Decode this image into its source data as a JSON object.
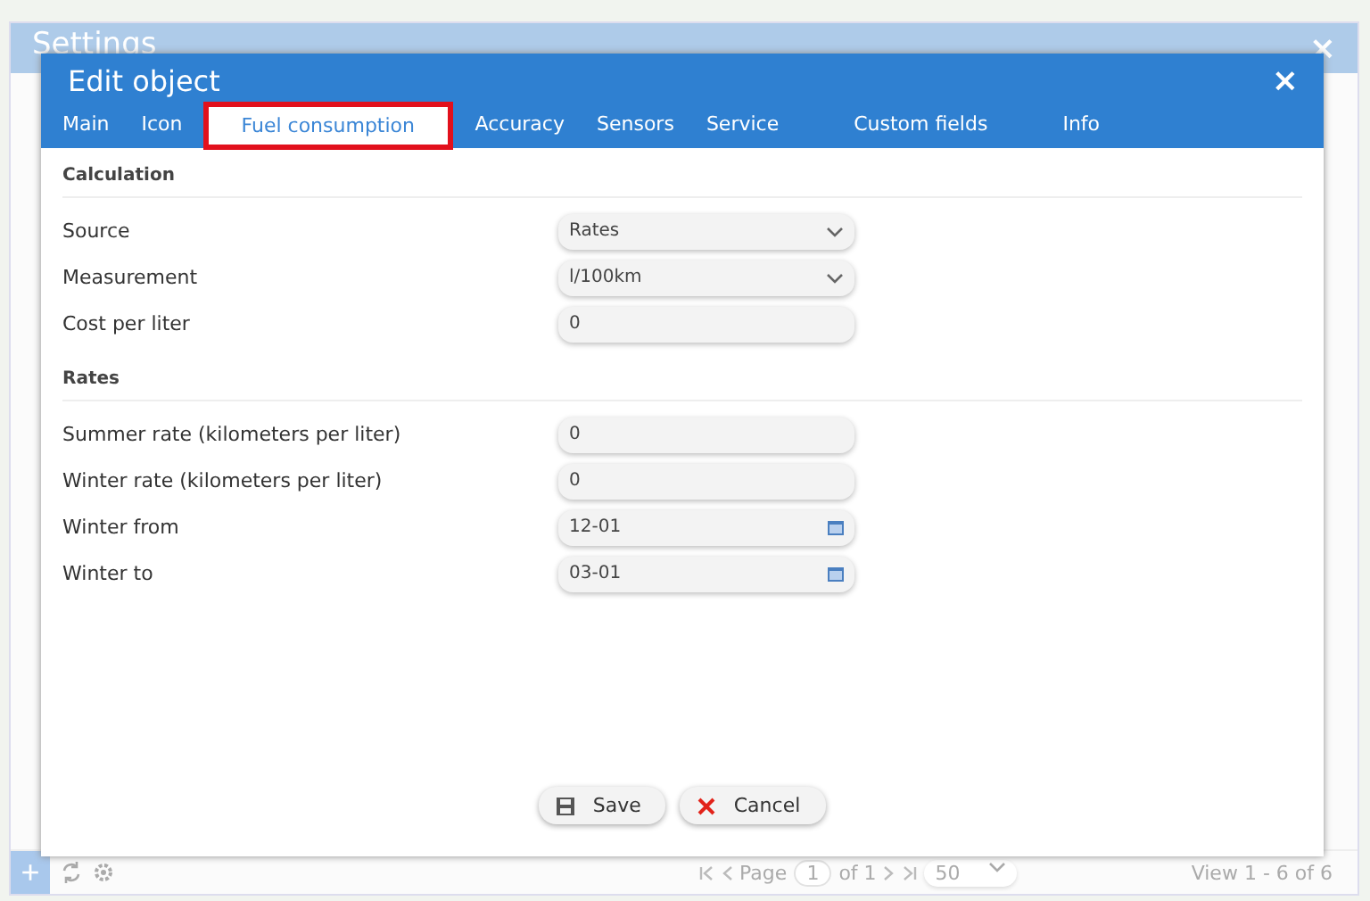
{
  "settings_window": {
    "title": "Settings",
    "close": "×",
    "footer": {
      "add": "+",
      "page_label": "Page",
      "page": "1",
      "of_pages": "of 1",
      "page_size": "50",
      "view_info": "View 1 - 6 of 6"
    }
  },
  "dialog": {
    "title": "Edit object",
    "close": "×",
    "tabs": [
      {
        "label": "Main",
        "selected": false
      },
      {
        "label": "Icon",
        "selected": false
      },
      {
        "label": "Fuel consumption",
        "selected": true
      },
      {
        "label": "Accuracy",
        "selected": false
      },
      {
        "label": "Sensors",
        "selected": false
      },
      {
        "label": "Service",
        "selected": false
      },
      {
        "label": "Custom fields",
        "selected": false
      },
      {
        "label": "Info",
        "selected": false
      }
    ],
    "sections": [
      {
        "title": "Calculation",
        "fields": [
          {
            "label": "Source",
            "kind": "select",
            "value": "Rates"
          },
          {
            "label": "Measurement",
            "kind": "select",
            "value": "l/100km"
          },
          {
            "label": "Cost per liter",
            "kind": "text",
            "value": "0"
          }
        ]
      },
      {
        "title": "Rates",
        "fields": [
          {
            "label": "Summer rate (kilometers per liter)",
            "kind": "text",
            "value": "0"
          },
          {
            "label": "Winter rate (kilometers per liter)",
            "kind": "text",
            "value": "0"
          },
          {
            "label": "Winter from",
            "kind": "date",
            "value": "12-01"
          },
          {
            "label": "Winter to",
            "kind": "date",
            "value": "03-01"
          }
        ]
      }
    ],
    "buttons": [
      {
        "label": "Save",
        "kind": "save"
      },
      {
        "label": "Cancel",
        "kind": "cancel"
      }
    ]
  }
}
